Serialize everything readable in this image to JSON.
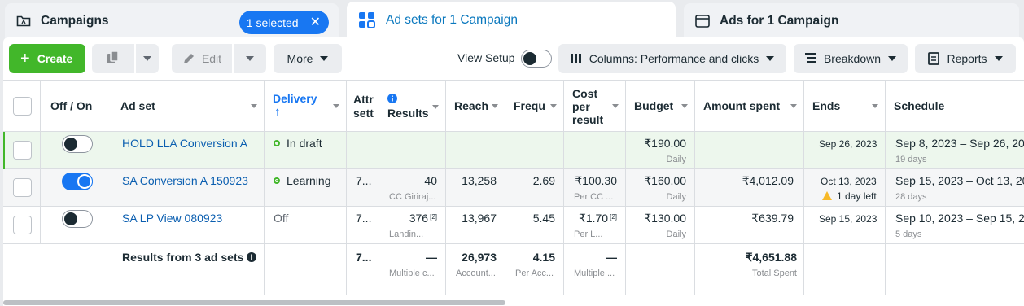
{
  "tabs": {
    "campaigns": "Campaigns",
    "selected": "1 selected",
    "adsets": "Ad sets for 1 Campaign",
    "ads": "Ads for 1 Campaign"
  },
  "toolbar": {
    "create": "Create",
    "edit": "Edit",
    "more": "More",
    "view_setup": "View Setup",
    "columns": "Columns: Performance and clicks",
    "breakdown": "Breakdown",
    "reports": "Reports"
  },
  "headers": {
    "offon": "Off / On",
    "adset": "Ad set",
    "delivery": "Delivery",
    "delivery_arrow": "↑",
    "attr": "Attr sett",
    "results": "Results",
    "reach": "Reach",
    "freq": "Frequ",
    "cost": "Cost per result",
    "budget": "Budget",
    "amount": "Amount spent",
    "ends": "Ends",
    "schedule": "Schedule"
  },
  "rows": [
    {
      "name": "HOLD LLA Conversion A",
      "delivery": "In draft",
      "attr": "—",
      "results": "—",
      "reach": "—",
      "freq": "—",
      "cost": "—",
      "budget": "₹190.00",
      "budget_sub": "Daily",
      "amount": "—",
      "ends": "Sep 26, 2023",
      "schedule": "Sep 8, 2023 – Sep 26, 20",
      "schedule_sub": "19 days"
    },
    {
      "name": "SA Conversion A 150923",
      "delivery": "Learning",
      "attr": "7...",
      "results": "40",
      "results_sub": "CC Giriraj...",
      "reach": "13,258",
      "freq": "2.69",
      "cost": "₹100.30",
      "cost_sub": "Per CC ...",
      "budget": "₹160.00",
      "budget_sub": "Daily",
      "amount": "₹4,012.09",
      "ends": "Oct 13, 2023",
      "ends_warn": "1 day left",
      "schedule": "Sep 15, 2023 – Oct 13, 20",
      "schedule_sub": "28 days"
    },
    {
      "name": "SA LP View 080923",
      "delivery": "Off",
      "attr": "7...",
      "results": "376",
      "results_sup": "[2]",
      "results_sub": "Landin...",
      "reach": "13,967",
      "freq": "5.45",
      "cost": "₹1.70",
      "cost_sup": "[2]",
      "cost_sub": "Per L...",
      "budget": "₹130.00",
      "budget_sub": "Daily",
      "amount": "₹639.79",
      "ends": "Sep 15, 2023",
      "schedule": "Sep 10, 2023 – Sep 15, 20",
      "schedule_sub": "5 days"
    }
  ],
  "totals": {
    "label": "Results from 3 ad sets",
    "attr": "7...",
    "results": "—",
    "results_sub": "Multiple c...",
    "reach": "26,973",
    "reach_sub": "Account...",
    "freq": "4.15",
    "freq_sub": "Per Acc...",
    "cost": "—",
    "cost_sub": "Multiple ...",
    "amount": "₹4,651.88",
    "amount_sub": "Total Spent"
  },
  "colors": {
    "accent": "#1877f2",
    "create_green": "#42b72a",
    "link": "#0a5eb0",
    "warning": "#f7b928"
  }
}
